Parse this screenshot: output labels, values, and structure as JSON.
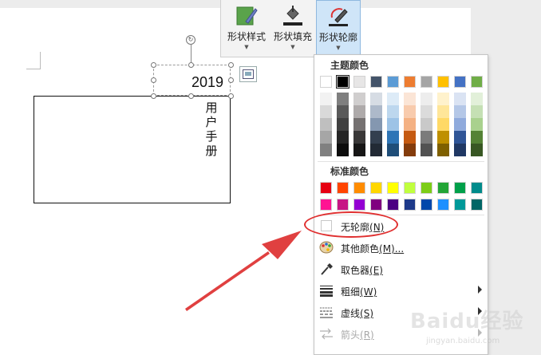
{
  "ribbon": {
    "buttons": [
      {
        "label": "形状样式",
        "icon": "shape-style-icon"
      },
      {
        "label": "形状填充",
        "icon": "paint-bucket-icon"
      },
      {
        "label": "形状轮廓",
        "icon": "pen-outline-icon"
      }
    ]
  },
  "document": {
    "textbox_text": "2019",
    "vertical_text": [
      "用",
      "户",
      "手",
      "册"
    ]
  },
  "menu": {
    "theme_title": "主题颜色",
    "standard_title": "标准颜色",
    "theme_colors": [
      "#ffffff",
      "#000000",
      "#e7e6e6",
      "#44546a",
      "#5b9bd5",
      "#ed7d31",
      "#a5a5a5",
      "#ffc000",
      "#4472c4",
      "#70ad47"
    ],
    "theme_shades": [
      [
        "#f2f2f2",
        "#d9d9d9",
        "#bfbfbf",
        "#a6a6a6",
        "#808080"
      ],
      [
        "#7f7f7f",
        "#595959",
        "#404040",
        "#262626",
        "#0d0d0d"
      ],
      [
        "#d0cece",
        "#aeaaaa",
        "#757171",
        "#3a3838",
        "#171616"
      ],
      [
        "#d6dce4",
        "#adb9ca",
        "#8497b0",
        "#333f4f",
        "#222a35"
      ],
      [
        "#ddebf7",
        "#bdd7ee",
        "#9dc3e6",
        "#2e75b6",
        "#1f4e79"
      ],
      [
        "#fbe5d6",
        "#f8cbad",
        "#f4b183",
        "#c55a11",
        "#843c0c"
      ],
      [
        "#ededed",
        "#dbdbdb",
        "#c9c9c9",
        "#7b7b7b",
        "#525252"
      ],
      [
        "#fff2cc",
        "#ffe699",
        "#ffd966",
        "#bf9000",
        "#7f6000"
      ],
      [
        "#dae3f3",
        "#b4c7e7",
        "#8faadc",
        "#2f5597",
        "#203864"
      ],
      [
        "#e2f0d9",
        "#c5e0b4",
        "#a9d18e",
        "#548235",
        "#385723"
      ]
    ],
    "standard_colors_row1": [
      "#e60012",
      "#ff4500",
      "#ff8c00",
      "#ffd700",
      "#ffff00",
      "#c0ff3e",
      "#7ccd17",
      "#23a537",
      "#00a04a",
      "#008b8b"
    ],
    "standard_colors_row2": [
      "#ff1493",
      "#c71585",
      "#9400d3",
      "#800080",
      "#4b0082",
      "#1e3a8a",
      "#0047ab",
      "#1e90ff",
      "#009999",
      "#006666"
    ],
    "items": [
      {
        "label": "无轮廓",
        "key": "(N)",
        "icon": "no-outline-icon",
        "submenu": false,
        "disabled": false
      },
      {
        "label": "其他颜色",
        "key": "(M)...",
        "icon": "palette-icon",
        "submenu": false,
        "disabled": false
      },
      {
        "label": "取色器",
        "key": "(E)",
        "icon": "eyedropper-icon",
        "submenu": false,
        "disabled": false
      },
      {
        "label": "粗细",
        "key": "(W)",
        "icon": "line-weight-icon",
        "submenu": true,
        "disabled": false
      },
      {
        "label": "虚线",
        "key": "(S)",
        "icon": "dash-line-icon",
        "submenu": true,
        "disabled": false
      },
      {
        "label": "箭头",
        "key": "(R)",
        "icon": "arrow-style-icon",
        "submenu": true,
        "disabled": true
      }
    ]
  },
  "watermark": {
    "main": "Baidu经验",
    "sub": "jingyan.baidu.com"
  },
  "colors": {
    "highlight": "#e03030",
    "accent_active": "#cfe5f8"
  }
}
